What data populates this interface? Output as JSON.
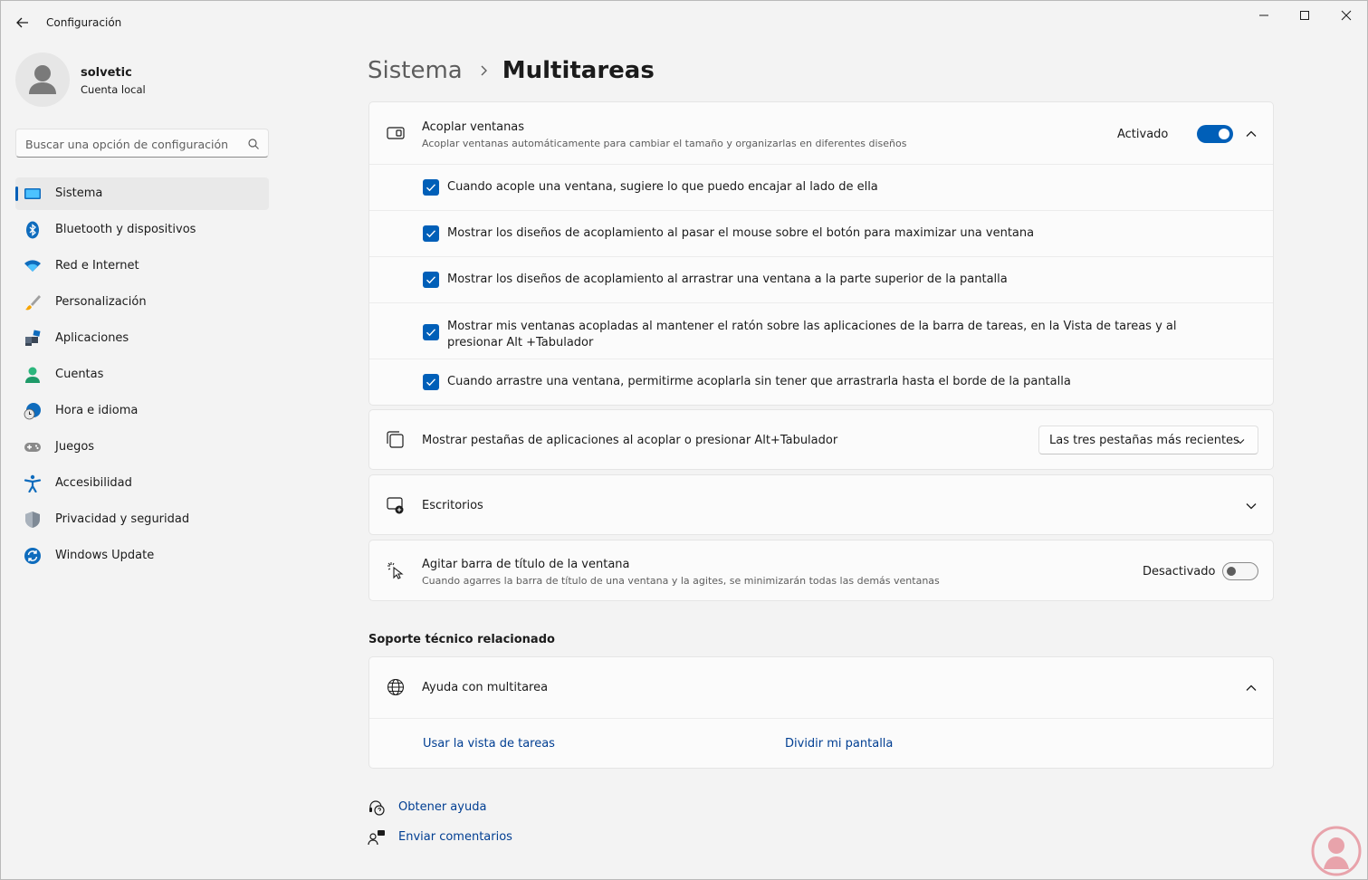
{
  "window": {
    "title": "Configuración"
  },
  "profile": {
    "name": "solvetic",
    "account_type": "Cuenta local"
  },
  "search": {
    "placeholder": "Buscar una opción de configuración"
  },
  "sidebar": {
    "items": [
      {
        "label": "Sistema",
        "icon": "monitor-icon",
        "active": true
      },
      {
        "label": "Bluetooth y dispositivos",
        "icon": "bluetooth-icon"
      },
      {
        "label": "Red e Internet",
        "icon": "wifi-icon"
      },
      {
        "label": "Personalización",
        "icon": "brush-icon"
      },
      {
        "label": "Aplicaciones",
        "icon": "apps-icon"
      },
      {
        "label": "Cuentas",
        "icon": "person-icon"
      },
      {
        "label": "Hora e idioma",
        "icon": "globe-clock-icon"
      },
      {
        "label": "Juegos",
        "icon": "gamepad-icon"
      },
      {
        "label": "Accesibilidad",
        "icon": "accessibility-icon"
      },
      {
        "label": "Privacidad y seguridad",
        "icon": "shield-icon"
      },
      {
        "label": "Windows Update",
        "icon": "update-icon"
      }
    ]
  },
  "breadcrumb": {
    "parent": "Sistema",
    "current": "Multitareas"
  },
  "snap": {
    "title": "Acoplar ventanas",
    "description": "Acoplar ventanas automáticamente para cambiar el tamaño y organizarlas en diferentes diseños",
    "state_label": "Activado",
    "enabled": true,
    "options": [
      {
        "label": "Cuando acople una ventana, sugiere lo que puedo encajar al lado de ella",
        "checked": true
      },
      {
        "label": "Mostrar los diseños de acoplamiento al pasar el mouse sobre el botón para maximizar una ventana",
        "checked": true
      },
      {
        "label": "Mostrar los diseños de acoplamiento al arrastrar una ventana a la parte superior de la pantalla",
        "checked": true
      },
      {
        "label": "Mostrar mis ventanas acopladas al mantener el ratón sobre las aplicaciones de la barra de tareas, en la Vista de tareas y al presionar Alt +Tabulador",
        "checked": true
      },
      {
        "label": "Cuando arrastre una ventana, permitirme acoplarla sin tener que arrastrarla hasta el borde de la pantalla",
        "checked": true
      }
    ]
  },
  "tabs_setting": {
    "title": "Mostrar pestañas de aplicaciones al acoplar o presionar Alt+Tabulador",
    "selected": "Las tres pestañas más recientes"
  },
  "desktops": {
    "title": "Escritorios"
  },
  "shake": {
    "title": "Agitar barra de título de la ventana",
    "description": "Cuando agarres la barra de título de una ventana y la agites, se minimizarán todas las demás ventanas",
    "state_label": "Desactivado",
    "enabled": false
  },
  "support": {
    "section_title": "Soporte técnico relacionado",
    "help_title": "Ayuda con multitarea",
    "links": [
      "Usar la vista de tareas",
      "Dividir mi pantalla"
    ]
  },
  "footer": {
    "get_help": "Obtener ayuda",
    "feedback": "Enviar comentarios"
  },
  "colors": {
    "accent": "#005fb8",
    "link": "#003e92",
    "background": "#f3f3f3",
    "card": "#fbfbfb"
  }
}
